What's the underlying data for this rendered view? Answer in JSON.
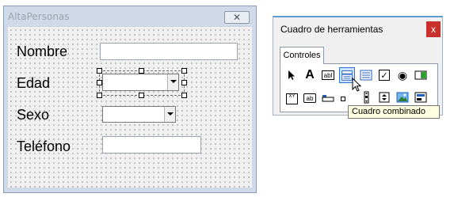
{
  "form": {
    "title": "AltaPersonas",
    "close_glyph": "✕",
    "labels": {
      "nombre": "Nombre",
      "edad": "Edad",
      "sexo": "Sexo",
      "telefono": "Teléfono"
    },
    "fields": {
      "nombre_value": "",
      "edad_value": "",
      "sexo_value": "",
      "telefono_value": ""
    }
  },
  "toolbox": {
    "title": "Cuadro de herramientas",
    "close_glyph": "x",
    "tab_label": "Controles",
    "tools": [
      {
        "name": "select-objects",
        "glyph": "pointer-icon"
      },
      {
        "name": "label",
        "glyph": "A"
      },
      {
        "name": "textbox",
        "glyph": "abl"
      },
      {
        "name": "combobox",
        "glyph": "combobox-icon",
        "selected": true
      },
      {
        "name": "listbox",
        "glyph": "listbox-icon"
      },
      {
        "name": "checkbox",
        "glyph": "✓"
      },
      {
        "name": "option-button",
        "glyph": "◉"
      },
      {
        "name": "toggle-button",
        "glyph": "toggle-icon"
      },
      {
        "name": "frame",
        "glyph": "XY"
      },
      {
        "name": "command-button",
        "glyph": "ab"
      },
      {
        "name": "tabstrip",
        "glyph": "tabstrip-icon"
      },
      {
        "name": "multipage",
        "glyph": "multipage-icon"
      },
      {
        "name": "scrollbar",
        "glyph": "scrollbar-icon"
      },
      {
        "name": "spinbutton",
        "glyph": "spin-icon"
      },
      {
        "name": "image",
        "glyph": "image-icon"
      },
      {
        "name": "refedit",
        "glyph": "refedit-icon"
      }
    ],
    "tooltip": "Cuadro combinado"
  },
  "colors": {
    "form_border": "#8a9bb4",
    "form_frame": "#cfd9e7",
    "toolbox_accent": "#5b9bd5",
    "close_red": "#c9302c",
    "selected_tool": "#cfe2ff",
    "tooltip_bg": "#ffffe1"
  }
}
